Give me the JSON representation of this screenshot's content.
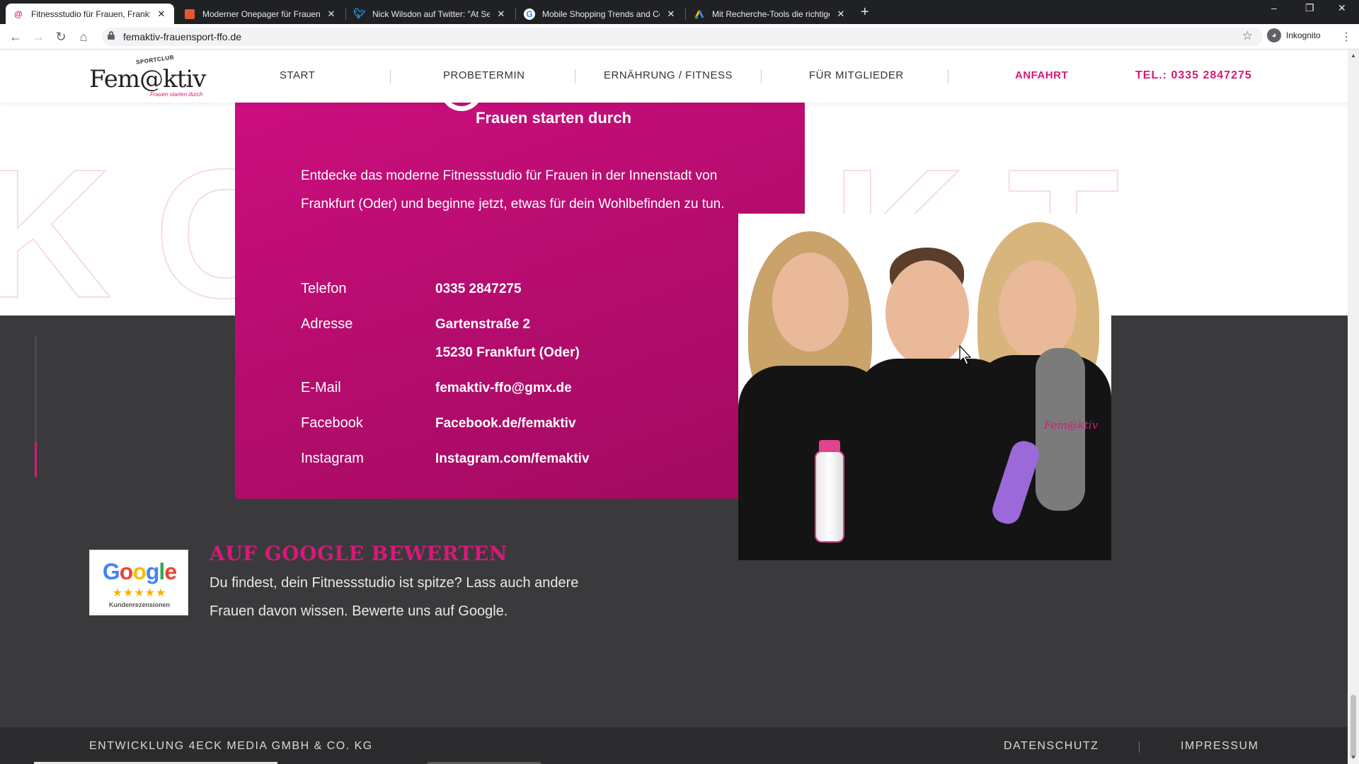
{
  "browser": {
    "tabs": [
      {
        "title": "Fitnessstudio für Frauen, Frankfurt",
        "icon": "femaktiv-favicon",
        "active": true
      },
      {
        "title": "Moderner Onepager für Frauen-",
        "icon": "orange-square-favicon",
        "active": false
      },
      {
        "title": "Nick Wilsdon auf Twitter: \"At Sea",
        "icon": "twitter-icon",
        "active": false
      },
      {
        "title": "Mobile Shopping Trends and Con",
        "icon": "google-icon",
        "active": false
      },
      {
        "title": "Mit Recherche-Tools die richtige",
        "icon": "google-ads-icon",
        "active": false
      }
    ],
    "new_tab": "+",
    "url": "femaktiv-frauensport-ffo.de",
    "profile_label": "Inkognito"
  },
  "site": {
    "logo": {
      "word": "Fem@ktiv",
      "club": "SPORTCLUB",
      "tagline": "Frauen starten durch"
    },
    "nav": [
      {
        "label": "START"
      },
      {
        "label": "PROBETERMIN"
      },
      {
        "label": "ERNÄHRUNG / FITNESS"
      },
      {
        "label": "FÜR MITGLIEDER"
      },
      {
        "label": "ANFAHRT",
        "active": true
      }
    ],
    "phone": "TEL.: 0335 2847275",
    "background_letters": "KONTAKT",
    "card": {
      "tagline": "Frauen starten durch",
      "intro": "Entdecke das moderne Fitnessstudio für Frauen in der Innenstadt von Frankfurt (Oder) und beginne jetzt, etwas für dein Wohlbefinden zu tun.",
      "contacts": [
        {
          "label": "Telefon",
          "value": "0335 2847275"
        },
        {
          "label": "Adresse",
          "value": "Gartenstraße 2",
          "value2": "15230 Frankfurt (Oder)"
        },
        {
          "label": "E-Mail",
          "value": "femaktiv-ffo@gmx.de"
        },
        {
          "label": "Facebook",
          "value": "Facebook.de/femaktiv"
        },
        {
          "label": "Instagram",
          "value": "Instagram.com/femaktiv"
        }
      ]
    },
    "photo": {
      "shirt_logo": "Fem@ktiv"
    },
    "google_review": {
      "badge_logo": "Google",
      "badge_stars": "★★★★★",
      "badge_caption": "Kundenrezensionen",
      "title": "AUF GOOGLE BEWERTEN",
      "text": "Du findest, dein Fitnessstudio ist spitze? Lass auch andere Frauen davon wissen. Bewerte uns auf Google."
    },
    "footer": {
      "developer": "ENTWICKLUNG 4ECK MEDIA GMBH & CO. KG",
      "links": [
        "DATENSCHUTZ",
        "IMPRESSUM"
      ]
    }
  },
  "colors": {
    "brand_pink": "#d6197a",
    "dark_bg": "#3a3a3c",
    "footer_bg": "#2b2b2d"
  }
}
